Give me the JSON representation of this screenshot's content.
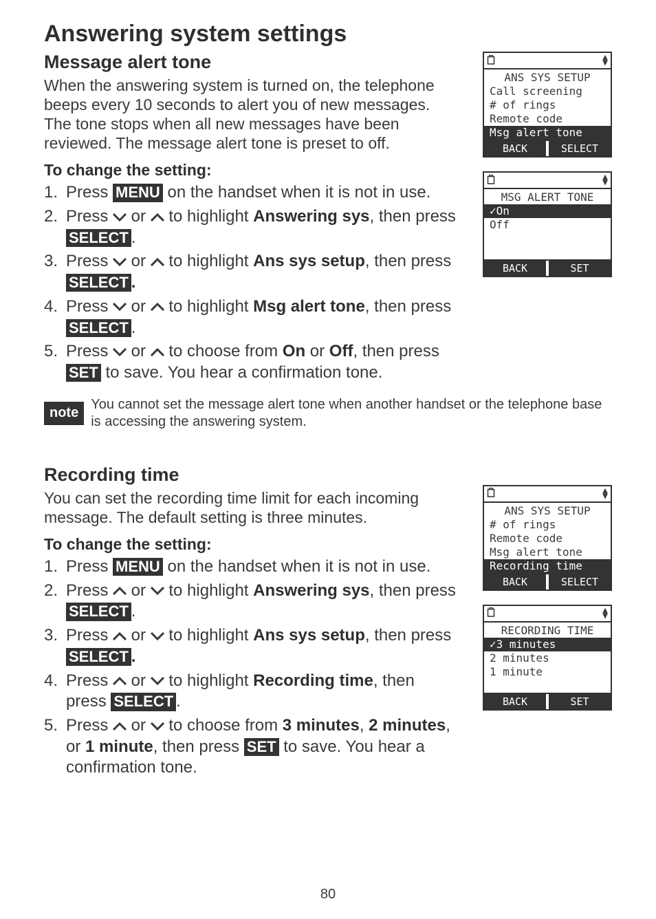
{
  "page": {
    "title": "Answering system settings",
    "number": "80"
  },
  "sec1": {
    "heading": "Message alert tone",
    "para": "When the answering system is turned on, the telephone beeps every 10 seconds to alert you of new messages. The tone stops when all new messages have been reviewed. The message alert tone is preset to off.",
    "sub": "To change the setting:",
    "s1a": "Press ",
    "s1b": " on the handset when it is not in use.",
    "s2a": "Press ",
    "s2b": " or ",
    "s2c": " to highlight ",
    "s2d": "Answering sys",
    "s2e": ", then press ",
    "s3a": "Press ",
    "s3b": " or ",
    "s3c": " to highlight ",
    "s3d": "Ans sys setup",
    "s3e": ", then press ",
    "s4a": "Press ",
    "s4b": " or ",
    "s4c": " to highlight ",
    "s4d": "Msg alert tone",
    "s4e": ", then press ",
    "s5a": "Press ",
    "s5b": " or ",
    "s5c": " to choose from ",
    "s5d": "On",
    "s5e": " or ",
    "s5f": "Off",
    "s5g": ", then press ",
    "s5h": " to save. You hear a confirmation tone."
  },
  "kbd": {
    "menu": "MENU",
    "select": "SELECT",
    "set": "SET"
  },
  "note": {
    "label": "note",
    "text": "You cannot set the message alert tone when another handset or the telephone base is accessing the answering system."
  },
  "sec2": {
    "heading": "Recording time",
    "para": "You can set the recording time limit for each incoming message. The default setting is three minutes.",
    "sub": "To change the setting:",
    "s1a": "Press ",
    "s1b": " on the handset when it is not in use.",
    "s2a": "Press ",
    "s2b": " or ",
    "s2c": " to highlight ",
    "s2d": "Answering sys",
    "s2e": ", then press ",
    "s3a": "Press ",
    "s3b": " or ",
    "s3c": " to highlight ",
    "s3d": "Ans sys setup",
    "s3e": ", then press ",
    "s4a": "Press ",
    "s4b": " or ",
    "s4c": " to highlight ",
    "s4d": "Recording time",
    "s4e": ", then press ",
    "s5a": "Press ",
    "s5b": " or ",
    "s5c": " to choose from ",
    "s5d": "3 minutes",
    "s5e": ", ",
    "s5f": "2 minutes",
    "s5g": ", or ",
    "s5h": "1 minute",
    "s5i": ", then press ",
    "s5j": " to save. You hear a confirmation tone."
  },
  "screens": {
    "a": {
      "title": "ANS SYS SETUP",
      "r1": "Call screening",
      "r2": "# of rings",
      "r3": "Remote code",
      "r4": "Msg alert tone",
      "b1": "BACK",
      "b2": "SELECT"
    },
    "b": {
      "title": "MSG ALERT TONE",
      "r1": "✓On",
      "r2": " Off",
      "b1": "BACK",
      "b2": "SET"
    },
    "c": {
      "title": "ANS SYS SETUP",
      "r1": "# of rings",
      "r2": "Remote code",
      "r3": "Msg alert tone",
      "r4": "Recording time",
      "b1": "BACK",
      "b2": "SELECT"
    },
    "d": {
      "title": "RECORDING TIME",
      "r1": "✓3 minutes",
      "r2": " 2 minutes",
      "r3": " 1 minute",
      "b1": "BACK",
      "b2": "SET"
    }
  }
}
